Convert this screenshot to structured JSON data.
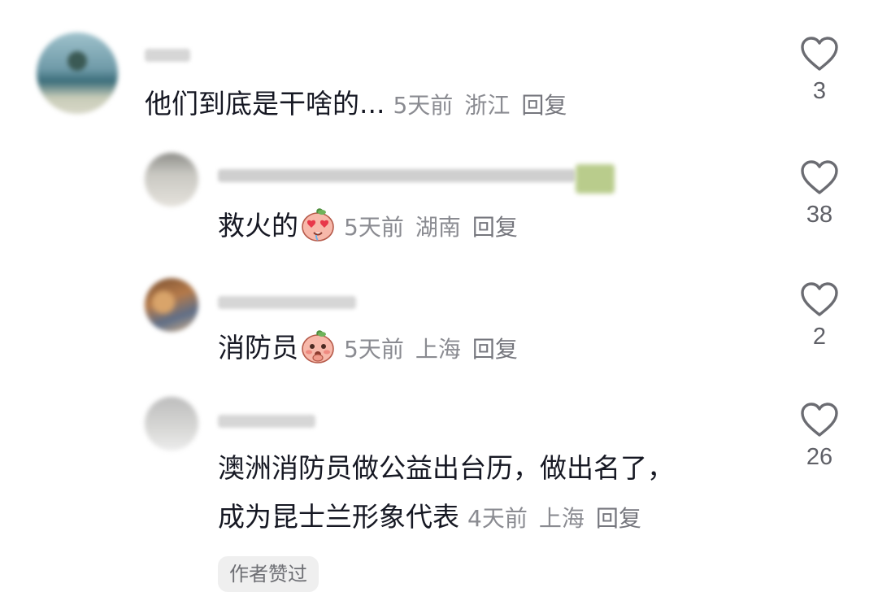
{
  "comments": [
    {
      "text": "他们到底是干啥的...",
      "time": "5天前",
      "location": "浙江",
      "reply_label": "回复",
      "likes": "3"
    },
    {
      "text": "救火的",
      "emoji": "heart-eyes-peach-emoji",
      "time": "5天前",
      "location": "湖南",
      "reply_label": "回复",
      "likes": "38"
    },
    {
      "text": "消防员",
      "emoji": "shy-peach-emoji",
      "time": "5天前",
      "location": "上海",
      "reply_label": "回复",
      "likes": "2"
    },
    {
      "text_line1": "澳洲消防员做公益出台历，做出名了，",
      "text_line2": "成为昆士兰形象代表",
      "time": "4天前",
      "location": "上海",
      "reply_label": "回复",
      "likes": "26"
    }
  ],
  "author_liked_label": "作者赞过",
  "colors": {
    "text": "#161823",
    "meta": "#8a8b91",
    "icon": "#6b6c72"
  }
}
